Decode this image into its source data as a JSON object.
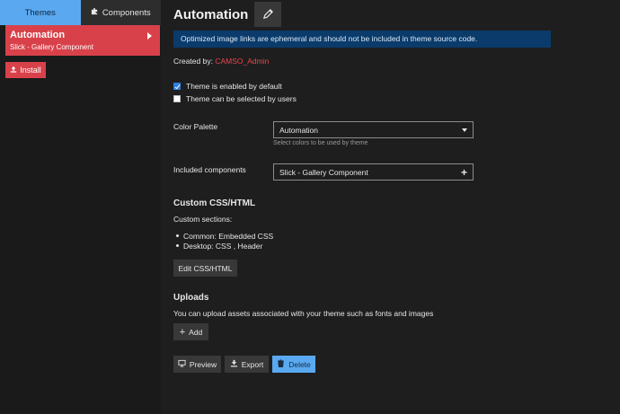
{
  "sidebar": {
    "tabs": [
      {
        "label": "Themes",
        "active": true
      },
      {
        "label": "Components",
        "active": false,
        "icon": "puzzle-icon"
      }
    ],
    "selected_theme": {
      "name": "Automation",
      "subtitle": "Slick - Gallery Component"
    },
    "install_label": "Install"
  },
  "main": {
    "title": "Automation",
    "banner": "Optimized image links are ephemeral and should not be included in theme source code.",
    "created_by_label": "Created by:",
    "created_by_user": "CAMSO_Admin",
    "checkboxes": [
      {
        "label": "Theme is enabled by default",
        "checked": true
      },
      {
        "label": "Theme can be selected by users",
        "checked": false
      }
    ],
    "color_palette": {
      "label": "Color Palette",
      "value": "Automation",
      "hint": "Select colors to be used by theme"
    },
    "included_components": {
      "label": "Included components",
      "value": "Slick - Gallery Component"
    },
    "custom_css": {
      "title": "Custom CSS/HTML",
      "sections_label": "Custom sections:",
      "items": [
        "Common: Embedded CSS",
        "Desktop: CSS , Header"
      ],
      "edit_label": "Edit CSS/HTML"
    },
    "uploads": {
      "title": "Uploads",
      "description": "You can upload assets associated with your theme such as fonts and images",
      "add_label": "Add"
    },
    "actions": {
      "preview": "Preview",
      "export": "Export",
      "delete": "Delete"
    }
  },
  "colors": {
    "accent_red": "#d9414a",
    "accent_blue": "#5aa9f0",
    "banner_bg": "#0a3b6b"
  }
}
